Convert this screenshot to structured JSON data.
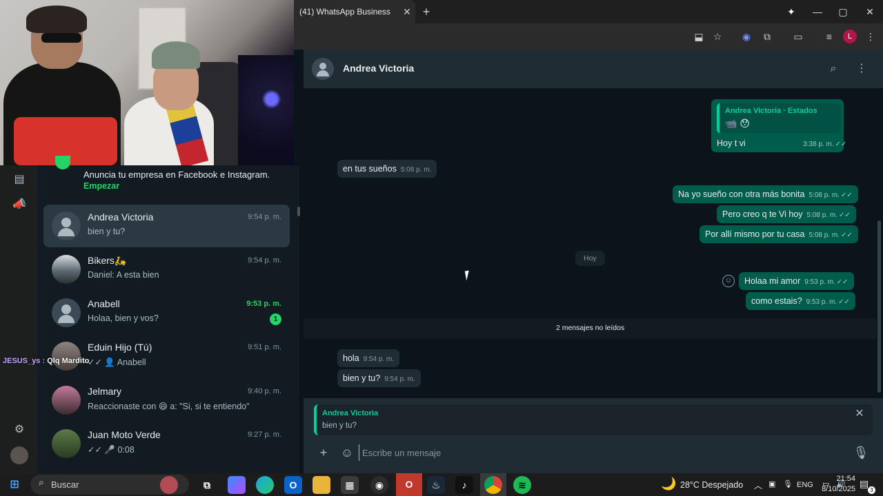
{
  "browser": {
    "tab_title": "(41) WhatsApp Business",
    "tab_close": "✕",
    "new_tab": "+",
    "window": {
      "minimize": "—",
      "maximize": "▢",
      "close": "✕"
    },
    "profile_initial": "L"
  },
  "webcam": {
    "overlay_user": "JESUS_ys",
    "overlay_sep": " : ",
    "overlay_text": "Qlq Mardito"
  },
  "promo": {
    "text": "Anuncia tu empresa en Facebook e Instagram.",
    "cta": "Empezar"
  },
  "chats": [
    {
      "name": "Andrea Victoria",
      "preview": "bien y tu?",
      "time": "9:54 p. m.",
      "active": true
    },
    {
      "name": "Bikers🛵",
      "preview": "Daniel: A esta bien",
      "time": "9:54 p. m."
    },
    {
      "name": "Anabell",
      "preview": "Holaa, bien y vos?",
      "time": "9:53 p. m.",
      "unread": "1"
    },
    {
      "name": "Eduin Hijo (Tú)",
      "preview": "✓✓ 👤 Anabell",
      "time": "9:51 p. m."
    },
    {
      "name": "Jelmary",
      "preview": "Reaccionaste con 😄 a: \"Si, si te entiendo\"",
      "time": "9:40 p. m."
    },
    {
      "name": "Juan Moto Verde",
      "preview": "✓✓ 🎤 0:08",
      "time": "9:27 p. m."
    }
  ],
  "conversation": {
    "contact_name": "Andrea Victoria",
    "status_quote": {
      "name": "Andrea Victoria · Estados",
      "body": "📹 😯"
    },
    "messages": [
      {
        "dir": "out",
        "text": "Hoy t vi",
        "time": "3:38 p. m."
      },
      {
        "dir": "in",
        "text": "en tus sueños",
        "time": "5:08 p. m."
      },
      {
        "dir": "out",
        "text": "Na yo sueño con otra más bonita",
        "time": "5:08 p. m."
      },
      {
        "dir": "out",
        "text": "Pero creo q te Vi hoy",
        "time": "5:08 p. m."
      },
      {
        "dir": "out",
        "text": "Por allí mismo por tu casa",
        "time": "5:08 p. m."
      },
      {
        "dir": "out",
        "text": "Holaa mi amor",
        "time": "9:53 p. m."
      },
      {
        "dir": "out",
        "text": "como estais?",
        "time": "9:53 p. m."
      },
      {
        "dir": "in",
        "text": "hola",
        "time": "9:54 p. m."
      },
      {
        "dir": "in",
        "text": "bien y tu?",
        "time": "9:54 p. m."
      }
    ],
    "day_divider": "Hoy",
    "unread_divider": "2 mensajes no leídos",
    "read_ticks": "✓✓"
  },
  "reply": {
    "name": "Andrea Victoria",
    "text": "bien y tu?"
  },
  "composer": {
    "placeholder": "Escribe un mensaje"
  },
  "taskbar": {
    "search_label": "Buscar",
    "weather": "28°C Despejado",
    "language": "ENG",
    "time": "21:54",
    "date": "8/10/2025",
    "notifications": "3"
  },
  "colors": {
    "accent": "#25d366",
    "outgoing_bubble": "#005c4b",
    "incoming_bubble": "#202c33",
    "background": "#0b141a"
  }
}
